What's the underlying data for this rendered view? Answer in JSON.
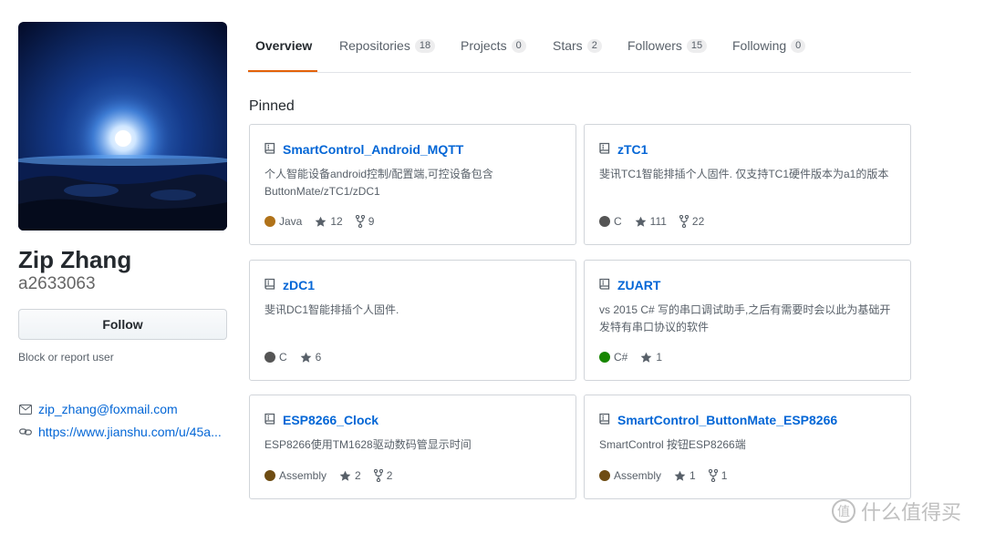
{
  "profile": {
    "fullname": "Zip Zhang",
    "username": "a2633063",
    "follow_label": "Follow",
    "block_label": "Block or report user",
    "email": "zip_zhang@foxmail.com",
    "url": "https://www.jianshu.com/u/45a..."
  },
  "tabs": [
    {
      "label": "Overview",
      "count": null
    },
    {
      "label": "Repositories",
      "count": "18"
    },
    {
      "label": "Projects",
      "count": "0"
    },
    {
      "label": "Stars",
      "count": "2"
    },
    {
      "label": "Followers",
      "count": "15"
    },
    {
      "label": "Following",
      "count": "0"
    }
  ],
  "pinned_title": "Pinned",
  "repos": [
    {
      "name": "SmartControl_Android_MQTT",
      "desc": "个人智能设备android控制/配置端,可控设备包含ButtonMate/zTC1/zDC1",
      "lang": "Java",
      "lang_color": "#b07219",
      "stars": "12",
      "forks": "9"
    },
    {
      "name": "zTC1",
      "desc": "斐讯TC1智能排插个人固件. 仅支持TC1硬件版本为a1的版本",
      "lang": "C",
      "lang_color": "#555555",
      "stars": "111",
      "forks": "22"
    },
    {
      "name": "zDC1",
      "desc": "斐讯DC1智能排插个人固件.",
      "lang": "C",
      "lang_color": "#555555",
      "stars": "6",
      "forks": null
    },
    {
      "name": "ZUART",
      "desc": "vs 2015 C# 写的串口调试助手,之后有需要时会以此为基础开发特有串口协议的软件",
      "lang": "C#",
      "lang_color": "#178600",
      "stars": "1",
      "forks": null
    },
    {
      "name": "ESP8266_Clock",
      "desc": "ESP8266使用TM1628驱动数码管显示时间",
      "lang": "Assembly",
      "lang_color": "#6E4C13",
      "stars": "2",
      "forks": "2"
    },
    {
      "name": "SmartControl_ButtonMate_ESP8266",
      "desc": "SmartControl 按钮ESP8266端",
      "lang": "Assembly",
      "lang_color": "#6E4C13",
      "stars": "1",
      "forks": "1"
    }
  ],
  "watermark": "什么值得买",
  "colors": {
    "link": "#0366d6",
    "active_tab": "#e36209"
  }
}
